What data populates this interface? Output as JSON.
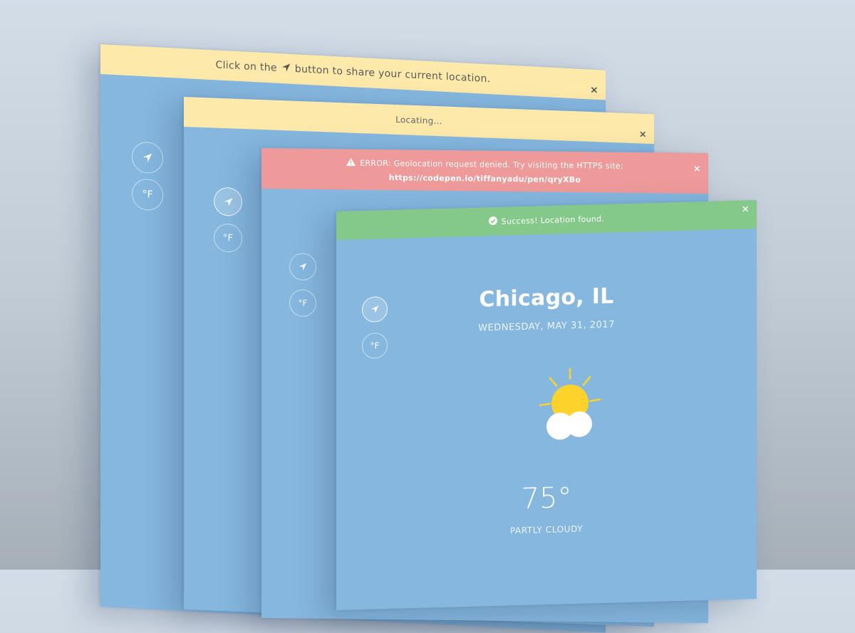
{
  "cards": [
    {
      "banner": {
        "type": "info",
        "text_before": "Click on the",
        "text_after": "button to share your current location.",
        "icon": "location-arrow-icon",
        "close": "×"
      },
      "controls": {
        "location_icon": "location-arrow-icon",
        "unit": "°F"
      }
    },
    {
      "banner": {
        "type": "info",
        "text": "Locating...",
        "close": "×"
      },
      "controls": {
        "location_icon": "location-arrow-icon",
        "unit": "°F",
        "location_active": true
      }
    },
    {
      "banner": {
        "type": "error",
        "icon": "warning-icon",
        "text": "ERROR: Geolocation request denied. Try visiting the HTTPS site:",
        "link": "https://codepen.io/tiffanyadu/pen/qryXBo",
        "close": "×"
      },
      "controls": {
        "location_icon": "location-arrow-icon",
        "unit": "°F"
      }
    },
    {
      "banner": {
        "type": "success",
        "icon": "check-circle-icon",
        "text": "Success! Location found.",
        "close": "×"
      },
      "controls": {
        "location_icon": "location-arrow-icon",
        "unit": "°F",
        "location_active": true
      },
      "weather": {
        "city": "Chicago, IL",
        "date": "WEDNESDAY, MAY 31, 2017",
        "icon": "partly-cloudy-icon",
        "temperature": "75°",
        "condition": "PARTLY CLOUDY"
      }
    }
  ],
  "colors": {
    "card_bg": "#85b7df",
    "info": "#fde9a9",
    "error": "#ee9a9a",
    "success": "#85c98a",
    "sun": "#fdd32b",
    "cloud": "#ffffff"
  }
}
